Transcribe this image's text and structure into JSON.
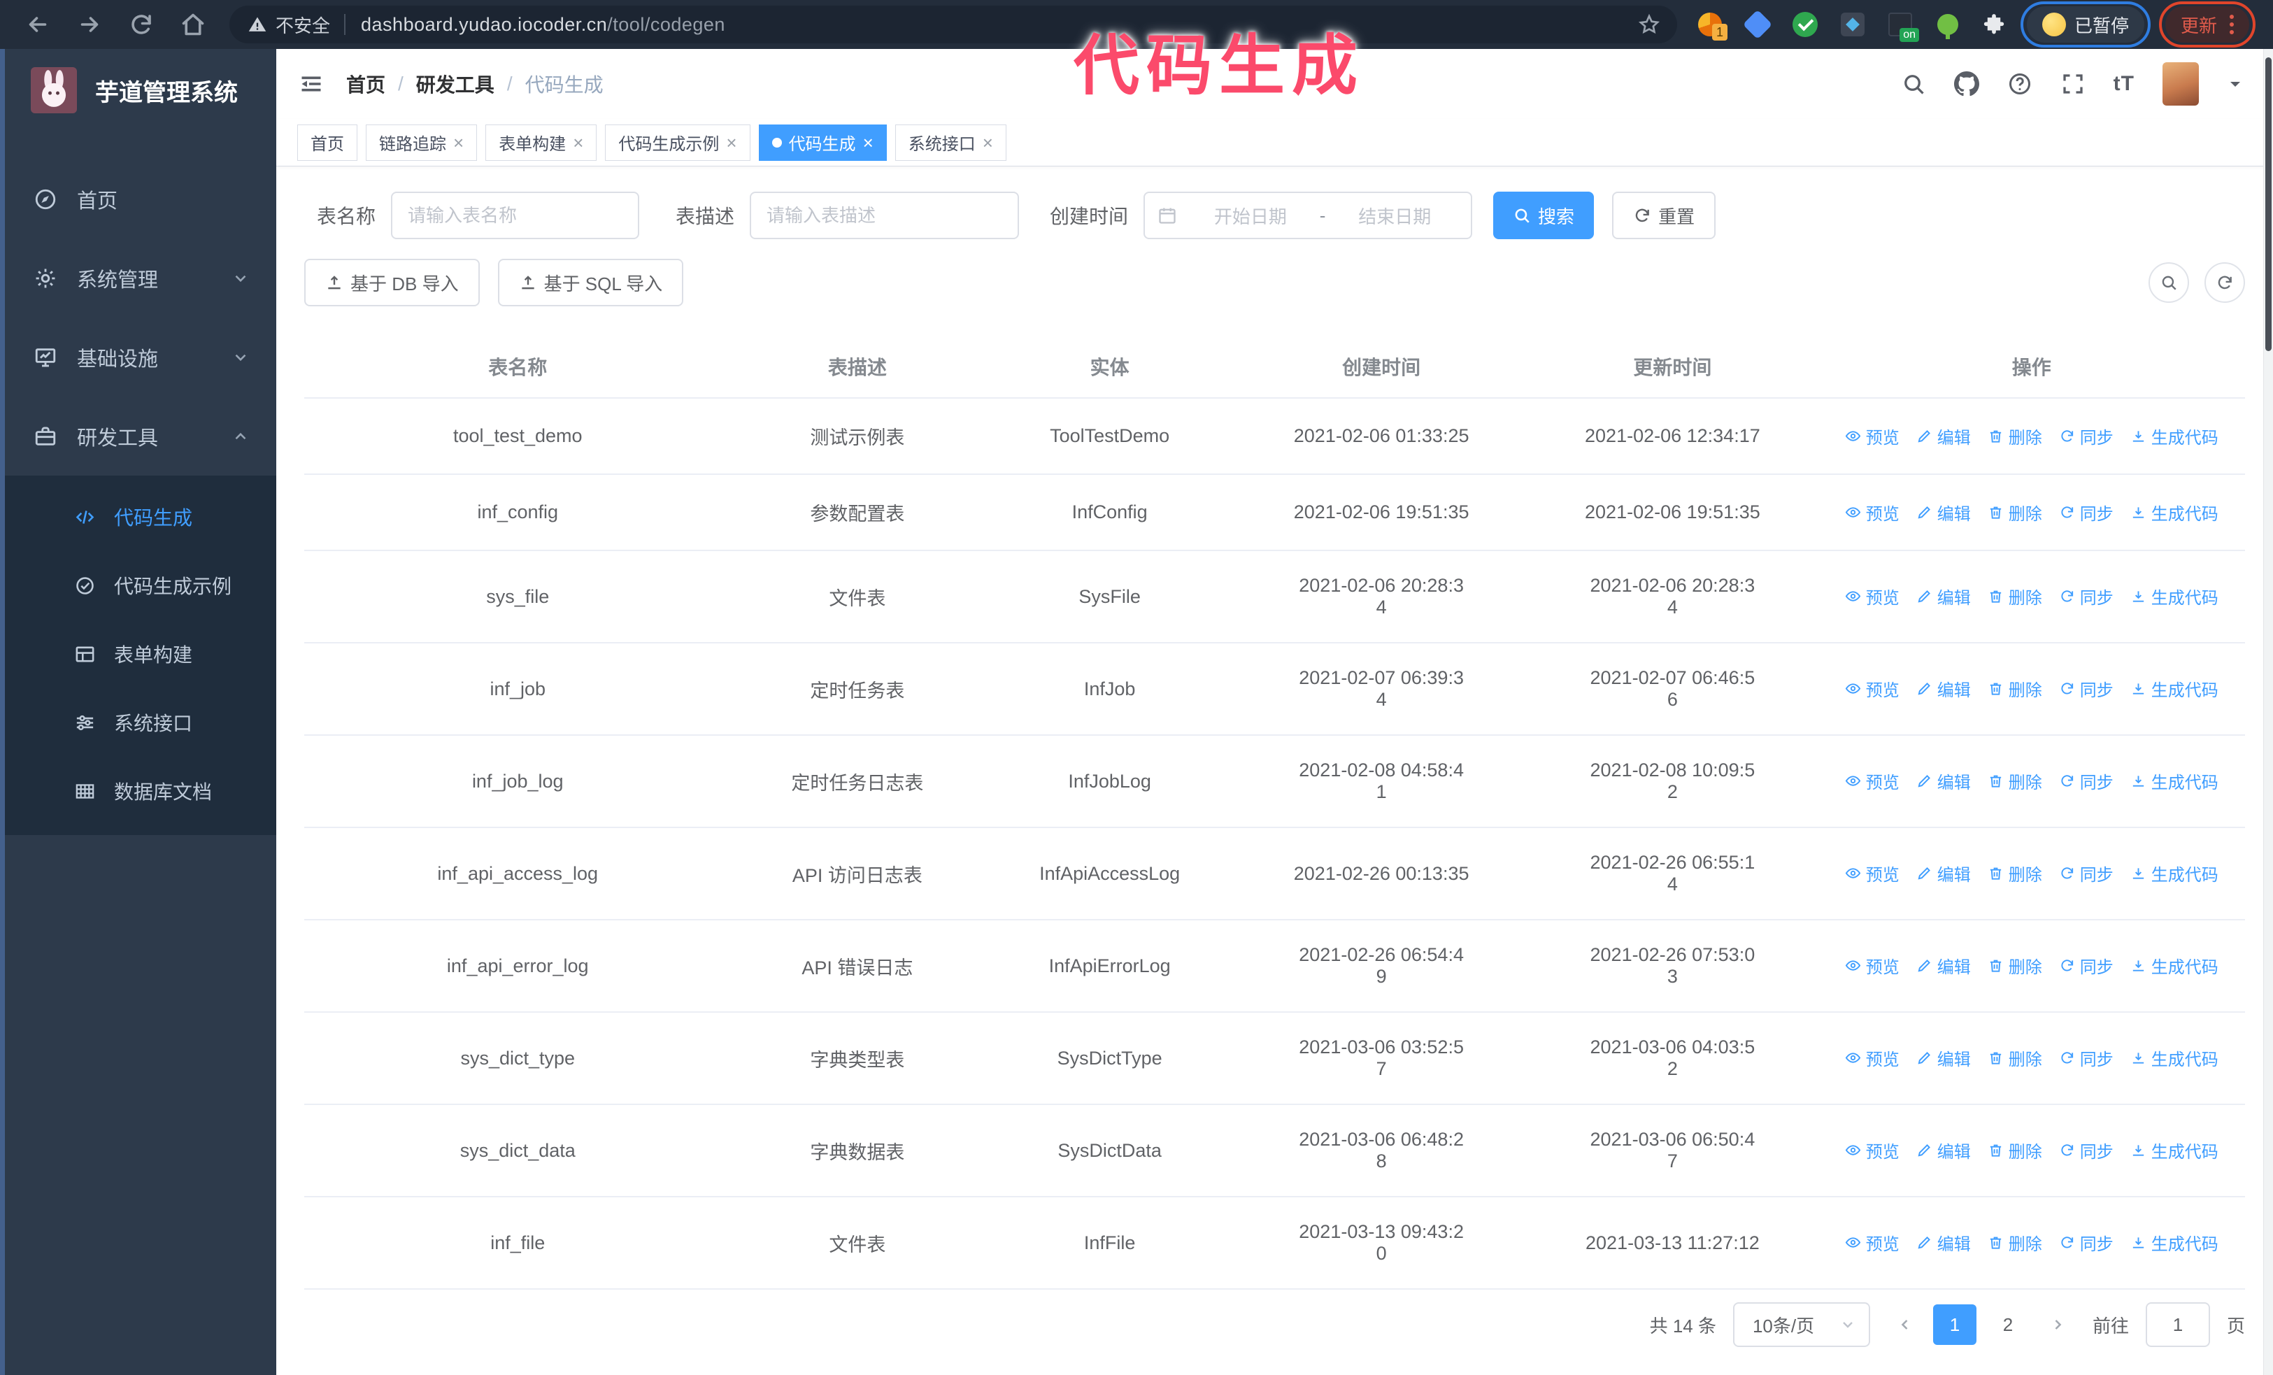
{
  "browser": {
    "security_label": "不安全",
    "url_host": "dashboard.yudao.iocoder.cn",
    "url_path": "/tool/codegen",
    "ext_badge_count": "1",
    "ext_badge_on": "on",
    "paused_label": "已暂停",
    "update_label": "更新"
  },
  "annotation": {
    "text": "代码生成",
    "color": "#fb4a6b"
  },
  "sidebar": {
    "app_title": "芋道管理系统",
    "items": [
      {
        "label": "首页",
        "icon": "home-icon"
      },
      {
        "label": "系统管理",
        "icon": "gear-icon",
        "chevron": "down"
      },
      {
        "label": "基础设施",
        "icon": "monitor-icon",
        "chevron": "down"
      },
      {
        "label": "研发工具",
        "icon": "briefcase-icon",
        "chevron": "up",
        "expanded": true
      }
    ],
    "submenu": [
      {
        "label": "代码生成",
        "icon": "code-icon",
        "active": true
      },
      {
        "label": "代码生成示例",
        "icon": "check-circle-icon"
      },
      {
        "label": "表单构建",
        "icon": "form-icon"
      },
      {
        "label": "系统接口",
        "icon": "sliders-icon"
      },
      {
        "label": "数据库文档",
        "icon": "db-table-icon"
      }
    ]
  },
  "header": {
    "breadcrumb": [
      "首页",
      "研发工具",
      "代码生成"
    ]
  },
  "tabs": [
    {
      "label": "首页",
      "closable": false,
      "active": false
    },
    {
      "label": "链路追踪",
      "closable": true,
      "active": false
    },
    {
      "label": "表单构建",
      "closable": true,
      "active": false
    },
    {
      "label": "代码生成示例",
      "closable": true,
      "active": false
    },
    {
      "label": "代码生成",
      "closable": true,
      "active": true
    },
    {
      "label": "系统接口",
      "closable": true,
      "active": false
    }
  ],
  "close_glyph": "×",
  "filters": {
    "name_label": "表名称",
    "name_placeholder": "请输入表名称",
    "desc_label": "表描述",
    "desc_placeholder": "请输入表描述",
    "time_label": "创建时间",
    "start_placeholder": "开始日期",
    "range_separator": "-",
    "end_placeholder": "结束日期",
    "search_label": "搜索",
    "reset_label": "重置"
  },
  "toolbar": {
    "import_db_label": "基于 DB 导入",
    "import_sql_label": "基于 SQL 导入"
  },
  "table": {
    "columns": [
      "表名称",
      "表描述",
      "实体",
      "创建时间",
      "更新时间",
      "操作"
    ],
    "actions": [
      {
        "label": "预览",
        "icon": "eye-icon"
      },
      {
        "label": "编辑",
        "icon": "edit-icon"
      },
      {
        "label": "删除",
        "icon": "delete-icon"
      },
      {
        "label": "同步",
        "icon": "sync-icon"
      },
      {
        "label": "生成代码",
        "icon": "download-icon"
      }
    ],
    "rows": [
      {
        "name": "tool_test_demo",
        "desc": "测试示例表",
        "entity": "ToolTestDemo",
        "created": "2021-02-06 01:33:25",
        "updated": "2021-02-06 12:34:17"
      },
      {
        "name": "inf_config",
        "desc": "参数配置表",
        "entity": "InfConfig",
        "created": "2021-02-06 19:51:35",
        "updated": "2021-02-06 19:51:35"
      },
      {
        "name": "sys_file",
        "desc": "文件表",
        "entity": "SysFile",
        "created": "2021-02-06 20:28:3\n4",
        "updated": "2021-02-06 20:28:3\n4"
      },
      {
        "name": "inf_job",
        "desc": "定时任务表",
        "entity": "InfJob",
        "created": "2021-02-07 06:39:3\n4",
        "updated": "2021-02-07 06:46:5\n6"
      },
      {
        "name": "inf_job_log",
        "desc": "定时任务日志表",
        "entity": "InfJobLog",
        "created": "2021-02-08 04:58:4\n1",
        "updated": "2021-02-08 10:09:5\n2"
      },
      {
        "name": "inf_api_access_log",
        "desc": "API 访问日志表",
        "entity": "InfApiAccessLog",
        "created": "2021-02-26 00:13:35",
        "updated": "2021-02-26 06:55:1\n4"
      },
      {
        "name": "inf_api_error_log",
        "desc": "API 错误日志",
        "entity": "InfApiErrorLog",
        "created": "2021-02-26 06:54:4\n9",
        "updated": "2021-02-26 07:53:0\n3"
      },
      {
        "name": "sys_dict_type",
        "desc": "字典类型表",
        "entity": "SysDictType",
        "created": "2021-03-06 03:52:5\n7",
        "updated": "2021-03-06 04:03:5\n2"
      },
      {
        "name": "sys_dict_data",
        "desc": "字典数据表",
        "entity": "SysDictData",
        "created": "2021-03-06 06:48:2\n8",
        "updated": "2021-03-06 06:50:4\n7"
      },
      {
        "name": "inf_file",
        "desc": "文件表",
        "entity": "InfFile",
        "created": "2021-03-13 09:43:2\n0",
        "updated": "2021-03-13 11:27:12"
      }
    ]
  },
  "pagination": {
    "total_label": "共 14 条",
    "page_size_label": "10条/页",
    "pages": [
      "1",
      "2"
    ],
    "active_page": "1",
    "goto_label": "前往",
    "goto_value": "1",
    "goto_suffix": "页"
  },
  "colors": {
    "accent": "#409eff",
    "sidebar_bg": "#2d3a4b",
    "submenu_bg": "#1f2d3d",
    "annotation": "#fb4a6b"
  }
}
